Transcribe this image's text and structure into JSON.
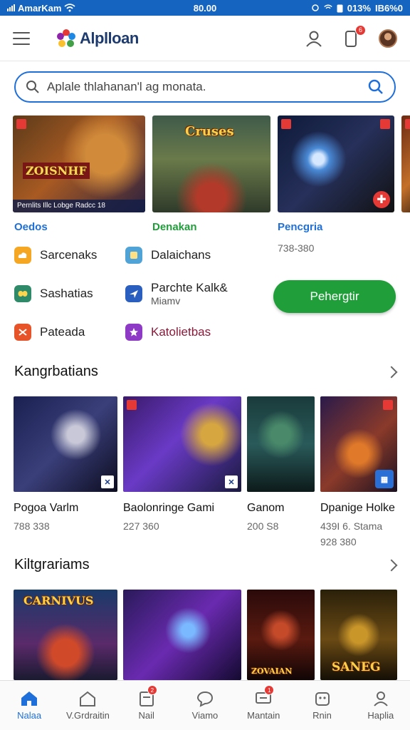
{
  "status_bar": {
    "carrier": "AmarKam",
    "time": "80.00",
    "battery": "013%",
    "extra": "IB6%0"
  },
  "header": {
    "app_name": "Alplloan",
    "notification_count": "6"
  },
  "search": {
    "placeholder": "Aplale thlahanan'l ag monata."
  },
  "featured": [
    {
      "name": "featured-card-1",
      "art_text": "ZOISNHF",
      "caption": "Pernlits Illc Lobge Radcc 18"
    },
    {
      "name": "featured-card-2",
      "art_text": "Cruses"
    },
    {
      "name": "featured-card-3",
      "art_text": ""
    },
    {
      "name": "featured-card-4",
      "art_text": ""
    }
  ],
  "category_headers": {
    "col1": "Oedos",
    "col2": "Denakan",
    "col3": "Pencgria",
    "col3_price": "738-380"
  },
  "categories_col1": [
    {
      "label": "Sarcenaks"
    },
    {
      "label": "Sashatias"
    },
    {
      "label": "Pateada"
    }
  ],
  "categories_col2": [
    {
      "label": "Dalaichans"
    },
    {
      "label": "Parchte Kalk&",
      "sub": "Miamv"
    },
    {
      "label": "Katolietbas"
    }
  ],
  "primary_button": {
    "label": "Pehergtir"
  },
  "section1": {
    "title": "Kangrbatians",
    "games": [
      {
        "name": "Pogoa Varlm",
        "meta": "788 338"
      },
      {
        "name": "Baolonringe Gami",
        "meta": "227 360"
      },
      {
        "name": "Ganom",
        "meta": "200 S8"
      },
      {
        "name": "Dpanige Holke",
        "meta": "439I 6. Stama",
        "meta2": "928 380"
      }
    ]
  },
  "section2": {
    "title": "Kiltgrariams",
    "games": [
      {
        "art_text": "CARNIVUS"
      },
      {
        "art_text": ""
      },
      {
        "art_text": "ZOVAIAN"
      },
      {
        "art_text": "SANEG"
      }
    ]
  },
  "bottom_nav": [
    {
      "label": "Nalaa",
      "active": true
    },
    {
      "label": "V.Grdraitin"
    },
    {
      "label": "Nail",
      "badge": "2"
    },
    {
      "label": "Viamo"
    },
    {
      "label": "Mantain",
      "badge": "1"
    },
    {
      "label": "Rnin"
    },
    {
      "label": "Haplia"
    }
  ],
  "colors": {
    "accent": "#1e6fd9",
    "primary_button": "#1f9e3a",
    "badge": "#e53935",
    "status_bar": "#1565c0"
  }
}
